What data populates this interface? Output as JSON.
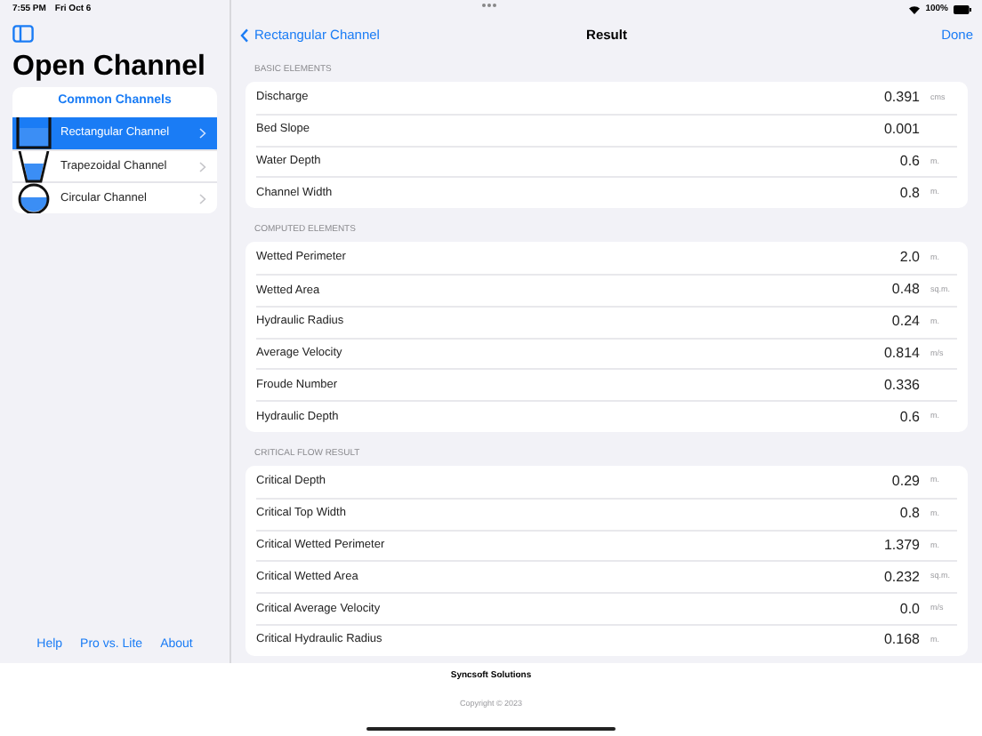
{
  "status_bar": {
    "time": "7:55 PM",
    "date": "Fri Oct 6",
    "battery": "100%"
  },
  "sidebar": {
    "title": "Open Channel",
    "section_title": "Common Channels",
    "items": [
      {
        "label": "Rectangular Channel",
        "kind": "rectangular",
        "selected": true
      },
      {
        "label": "Trapezoidal Channel",
        "kind": "trapezoidal",
        "selected": false
      },
      {
        "label": "Circular Channel",
        "kind": "circular",
        "selected": false
      }
    ],
    "links": [
      "Help",
      "Pro vs. Lite",
      "About"
    ]
  },
  "nav": {
    "back": "Rectangular Channel",
    "title": "Result",
    "done": "Done"
  },
  "sections": [
    {
      "header": "BASIC ELEMENTS",
      "rows": [
        {
          "label": "Discharge",
          "value": "0.391",
          "unit": "cms"
        },
        {
          "label": "Bed Slope",
          "value": "0.001"
        },
        {
          "label": "Water Depth",
          "value": "0.6",
          "unit": "m."
        },
        {
          "label": "Channel Width",
          "value": "0.8",
          "unit": "m."
        }
      ]
    },
    {
      "header": "COMPUTED ELEMENTS",
      "rows": [
        {
          "label": "Wetted Perimeter",
          "value": "2.0",
          "unit": "m."
        },
        {
          "label": "Wetted Area",
          "value": "0.48",
          "unit": "sq.m."
        },
        {
          "label": "Hydraulic Radius",
          "value": "0.24",
          "unit": "m."
        },
        {
          "label": "Average Velocity",
          "value": "0.814",
          "unit": "m/s"
        },
        {
          "label": "Froude Number",
          "value": "0.336"
        },
        {
          "label": "Hydraulic Depth",
          "value": "0.6",
          "unit": "m."
        }
      ]
    },
    {
      "header": "CRITICAL FLOW RESULT",
      "rows": [
        {
          "label": "Critical Depth",
          "value": "0.29",
          "unit": "m."
        },
        {
          "label": "Critical Top Width",
          "value": "0.8",
          "unit": "m."
        },
        {
          "label": "Critical Wetted Perimeter",
          "value": "1.379",
          "unit": "m."
        },
        {
          "label": "Critical Wetted Area",
          "value": "0.232",
          "unit": "sq.m."
        },
        {
          "label": "Critical Average Velocity",
          "value": "0.0",
          "unit": "m/s"
        },
        {
          "label": "Critical Hydraulic Radius",
          "value": "0.168",
          "unit": "m."
        }
      ]
    }
  ],
  "footer": {
    "company": "Syncsoft Solutions",
    "copyright": "Copyright © 2023"
  }
}
